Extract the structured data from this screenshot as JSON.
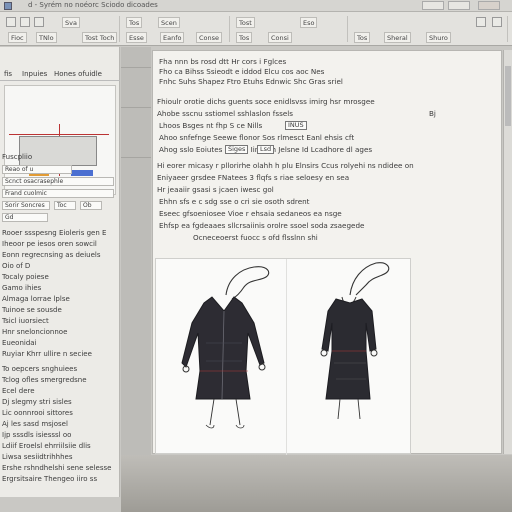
{
  "window": {
    "title": "d - Syrém no noéorc Sciodo dicoades"
  },
  "ribbon": {
    "buttons": [
      "Fioc",
      "TNlo",
      "Sva",
      "Tost Toch",
      "Tos",
      "Esse",
      "Scen",
      "Eanfo",
      "Conse",
      "Tost",
      "Tos",
      "Consi",
      "Eso",
      "Tos",
      "Sheral",
      "Shuro"
    ]
  },
  "left_panel": {
    "tabs": [
      "fis",
      "Inpuies",
      "Hones ofuidle"
    ],
    "fields": [
      "Fuscpliio",
      "Reao of u",
      "Scnct osacrasephle",
      "Frand cuolmic",
      "Sorir Soncres"
    ],
    "mini_fields": [
      "Toc",
      "Ob",
      "Gd"
    ],
    "lines": [
      "Rooer ssspesng Eioleris gen E",
      "Iheoor pe iesos oren sowcil",
      "Eonn regrecnsing as deiuels",
      "Oio of D",
      "Tocaly poiese",
      "Gamo ihies",
      "Almaga lorrae lplse",
      "Tuinoe se sousde",
      "Tsicl iuorsiect",
      "Hnr sneloncionnoe",
      "Eueonidai",
      "Ruyiar Khrr ullire n seciee",
      "To oepcers snghuiees",
      "Tclog ofles smergredsne",
      "Ecel dere",
      "Dj slegmy stri sisles",
      "Lic  oonnrooi sittores",
      "Aj  les sasd msjosel",
      "Ijp sssdls isiesssl oo",
      "Ldiif Eroelsl ehrriilsiie dlis",
      "Liwsa sesiidtrihhhes",
      "Ershe rshndhelshi sene selesse",
      "Ergrsitsaire Thengeo iiro ss"
    ]
  },
  "document": {
    "header_lines": [
      "Fha nnn bs rosd  dtt Hr cors  i Fglces",
      "Fho ca Bihss  Ssieodt  e iddod  Elcu cos  aoc Nes",
      "Fnhc Suhs  Shapez  Ftro Etuhs  Ednwic Shc  Gras  sriel",
      "Fhioulr orotie dichs guents soce enidlsvss imirg hsr mrosgee",
      "Ahobe  sscnu sstiomel sshlaslon fssels",
      "Lhoos  Bsges   nt fhp  S  ce   Nills",
      "Ahoo snfefnge  Seewe flonor  Sos  rlmesct  Eanl  ehsis cft",
      "Ahog  sslo Eoiutes  Ssinoe   Iinzalih  Jelsne  Id   Lcadhore  dl ages",
      "Hi eorer micasy r pllorirhe  olahh h plu  Elnsirs  Ccus rolyehi  ns ndidee  on",
      "Eniyaeer grsdee  FNatees  3 flqfs s riae seloesy en  sea",
      "Hr jeaaiir gsasi s jcaen  iwesc gol",
      "Ehhn  sfs e c sdg sse  o cri sie osoth sdrent",
      "Eseec gfsoeniosee  Vioe r ehsaia  sedaneos  ea nsge",
      "Ehfsp ea fgdeaaes sllcrsaiinis orolre ssoel soda zsaegede",
      "Ocneceoerst  fuocc  s ofd  flsslnn  shi"
    ],
    "chips": [
      "Siges",
      "INUS",
      "Eset",
      "Lsd"
    ],
    "page_tag": "Bj"
  },
  "figure": {
    "left_label": "coat-left",
    "right_label": "dress-right"
  }
}
